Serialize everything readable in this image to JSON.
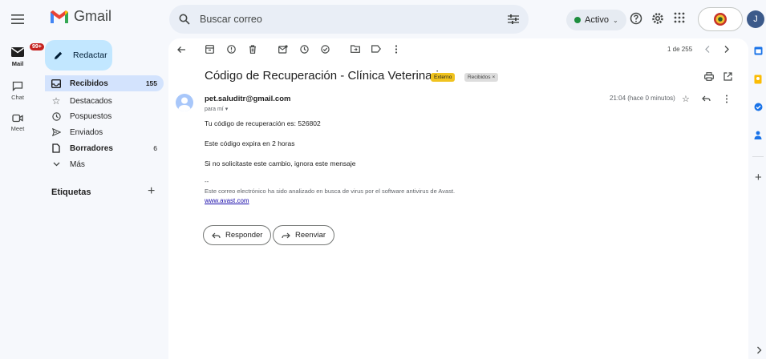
{
  "app": {
    "name": "Gmail",
    "colors": {
      "accent": "#0b57d0",
      "compose_bg": "#c2e7ff",
      "active_nav": "#d3e3fd",
      "external_tag": "#f0c31f",
      "status_green": "#1e8e3e",
      "mail_badge": "#c5221f"
    }
  },
  "header": {
    "search_placeholder": "Buscar correo",
    "status_label": "Activo",
    "avatar_initial": "J",
    "icons": [
      "menu-icon",
      "search-icon",
      "filter-icon",
      "help-icon",
      "settings-icon",
      "apps-icon",
      "account-icon"
    ]
  },
  "rail": {
    "mail": {
      "label": "Mail",
      "badge": "99+"
    },
    "chat": {
      "label": "Chat"
    },
    "meet": {
      "label": "Meet"
    }
  },
  "sidebar": {
    "compose_label": "Redactar",
    "items": [
      {
        "label": "Recibidos",
        "count": "155",
        "icon": "inbox-icon"
      },
      {
        "label": "Destacados",
        "count": "",
        "icon": "star-icon"
      },
      {
        "label": "Pospuestos",
        "count": "",
        "icon": "clock-icon"
      },
      {
        "label": "Enviados",
        "count": "",
        "icon": "send-icon"
      },
      {
        "label": "Borradores",
        "count": "6",
        "icon": "draft-icon"
      },
      {
        "label": "Más",
        "count": "",
        "icon": "chevron-down-icon"
      }
    ],
    "labels_title": "Etiquetas"
  },
  "toolbar": {
    "page_count": "1 de 255"
  },
  "message": {
    "subject": "Código de Recuperación - Clínica Veterinaria",
    "tags": {
      "external": "Externo",
      "inbox": "Recibidos"
    },
    "sender": "pet.saluditr@gmail.com",
    "to_me": "para mí",
    "timestamp": "21:04 (hace 0 minutos)",
    "body": [
      "Tu código de recuperación es: 526802",
      "Este código expira en 2 horas",
      "Si no solicitaste este cambio, ignora este mensaje"
    ],
    "signature_dots": "--",
    "avast_note": "Este correo electrónico ha sido analizado en busca de virus por el software antivirus de Avast.",
    "avast_link": "www.avast.com",
    "reply_label": "Responder",
    "forward_label": "Reenviar"
  }
}
